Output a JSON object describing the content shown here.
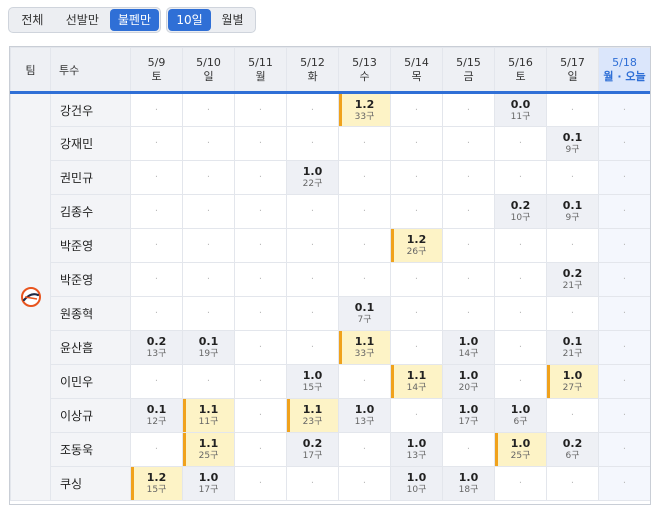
{
  "filter_tabs": [
    {
      "label": "전체",
      "active": false
    },
    {
      "label": "선발만",
      "active": false
    },
    {
      "label": "불펜만",
      "active": true
    }
  ],
  "period_tabs": [
    {
      "label": "10일",
      "active": true
    },
    {
      "label": "월별",
      "active": false
    }
  ],
  "headers": {
    "team": "팀",
    "pitcher": "투수"
  },
  "days": [
    {
      "date": "5/9",
      "weekday": "토"
    },
    {
      "date": "5/10",
      "weekday": "일"
    },
    {
      "date": "5/11",
      "weekday": "월"
    },
    {
      "date": "5/12",
      "weekday": "화"
    },
    {
      "date": "5/13",
      "weekday": "수"
    },
    {
      "date": "5/14",
      "weekday": "목"
    },
    {
      "date": "5/15",
      "weekday": "금"
    },
    {
      "date": "5/16",
      "weekday": "토"
    },
    {
      "date": "5/17",
      "weekday": "일"
    },
    {
      "date": "5/18",
      "weekday": "월 · 오늘",
      "today": true
    }
  ],
  "team": {
    "logo": "giants-logo-icon",
    "accent": "#e8541e"
  },
  "empty_mark": "·",
  "rows": [
    {
      "name": "강건우",
      "cells": [
        null,
        null,
        null,
        null,
        {
          "ip": "1.2",
          "pc": "33구",
          "heavy": true
        },
        null,
        null,
        {
          "ip": "0.0",
          "pc": "11구"
        },
        null,
        null
      ]
    },
    {
      "name": "강재민",
      "cells": [
        null,
        null,
        null,
        null,
        null,
        null,
        null,
        null,
        {
          "ip": "0.1",
          "pc": "9구"
        },
        null
      ]
    },
    {
      "name": "권민규",
      "cells": [
        null,
        null,
        null,
        {
          "ip": "1.0",
          "pc": "22구"
        },
        null,
        null,
        null,
        null,
        null,
        null
      ]
    },
    {
      "name": "김종수",
      "cells": [
        null,
        null,
        null,
        null,
        null,
        null,
        null,
        {
          "ip": "0.2",
          "pc": "10구"
        },
        {
          "ip": "0.1",
          "pc": "9구"
        },
        null
      ]
    },
    {
      "name": "박준영",
      "cells": [
        null,
        null,
        null,
        null,
        null,
        {
          "ip": "1.2",
          "pc": "26구",
          "heavy": true
        },
        null,
        null,
        null,
        null
      ]
    },
    {
      "name": "박준영",
      "cells": [
        null,
        null,
        null,
        null,
        null,
        null,
        null,
        null,
        {
          "ip": "0.2",
          "pc": "21구"
        },
        null
      ]
    },
    {
      "name": "원종혁",
      "cells": [
        null,
        null,
        null,
        null,
        {
          "ip": "0.1",
          "pc": "7구"
        },
        null,
        null,
        null,
        null,
        null
      ]
    },
    {
      "name": "윤산흠",
      "cells": [
        {
          "ip": "0.2",
          "pc": "13구"
        },
        {
          "ip": "0.1",
          "pc": "19구"
        },
        null,
        null,
        {
          "ip": "1.1",
          "pc": "33구",
          "heavy": true
        },
        null,
        {
          "ip": "1.0",
          "pc": "14구"
        },
        null,
        {
          "ip": "0.1",
          "pc": "21구"
        },
        null
      ]
    },
    {
      "name": "이민우",
      "cells": [
        null,
        null,
        null,
        {
          "ip": "1.0",
          "pc": "15구"
        },
        null,
        {
          "ip": "1.1",
          "pc": "14구",
          "heavy": true
        },
        {
          "ip": "1.0",
          "pc": "20구"
        },
        null,
        {
          "ip": "1.0",
          "pc": "27구",
          "heavy": true
        },
        null
      ]
    },
    {
      "name": "이상규",
      "cells": [
        {
          "ip": "0.1",
          "pc": "12구"
        },
        {
          "ip": "1.1",
          "pc": "11구",
          "heavy": true
        },
        null,
        {
          "ip": "1.1",
          "pc": "23구",
          "heavy": true
        },
        {
          "ip": "1.0",
          "pc": "13구"
        },
        null,
        {
          "ip": "1.0",
          "pc": "17구"
        },
        {
          "ip": "1.0",
          "pc": "6구"
        },
        null,
        null
      ]
    },
    {
      "name": "조동욱",
      "cells": [
        null,
        {
          "ip": "1.1",
          "pc": "25구",
          "heavy": true
        },
        null,
        {
          "ip": "0.2",
          "pc": "17구"
        },
        null,
        {
          "ip": "1.0",
          "pc": "13구"
        },
        null,
        {
          "ip": "1.0",
          "pc": "25구",
          "heavy": true
        },
        {
          "ip": "0.2",
          "pc": "6구"
        },
        null
      ]
    },
    {
      "name": "쿠싱",
      "cells": [
        {
          "ip": "1.2",
          "pc": "15구",
          "heavy": true
        },
        {
          "ip": "1.0",
          "pc": "17구"
        },
        null,
        null,
        null,
        {
          "ip": "1.0",
          "pc": "10구"
        },
        {
          "ip": "1.0",
          "pc": "18구"
        },
        null,
        null,
        null
      ]
    }
  ]
}
